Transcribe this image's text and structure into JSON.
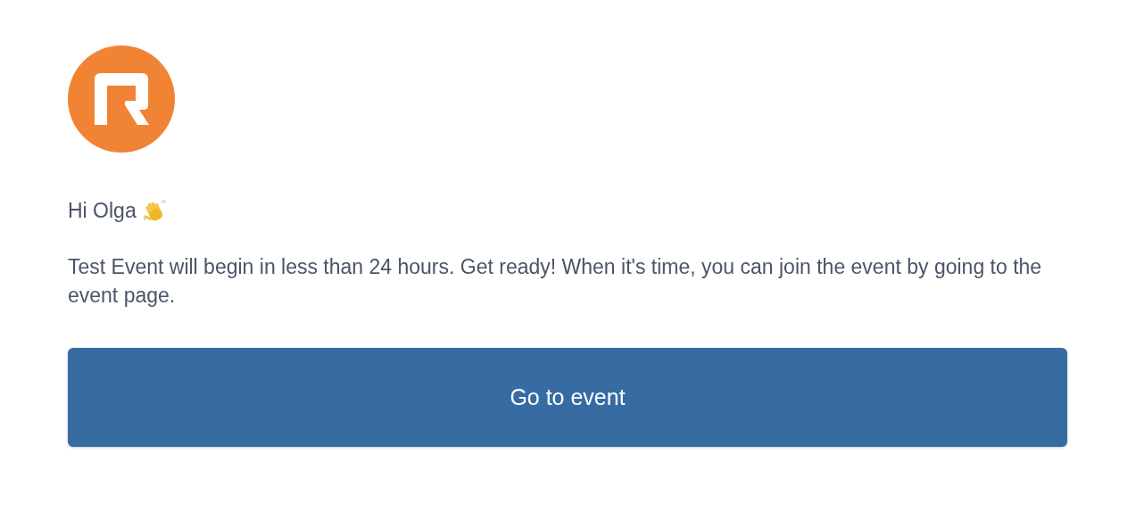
{
  "greeting": "Hi Olga",
  "message": "Test Event will begin in less than 24 hours. Get ready! When it's time, you can join the event by going to the event page.",
  "button": {
    "label": "Go to event"
  }
}
